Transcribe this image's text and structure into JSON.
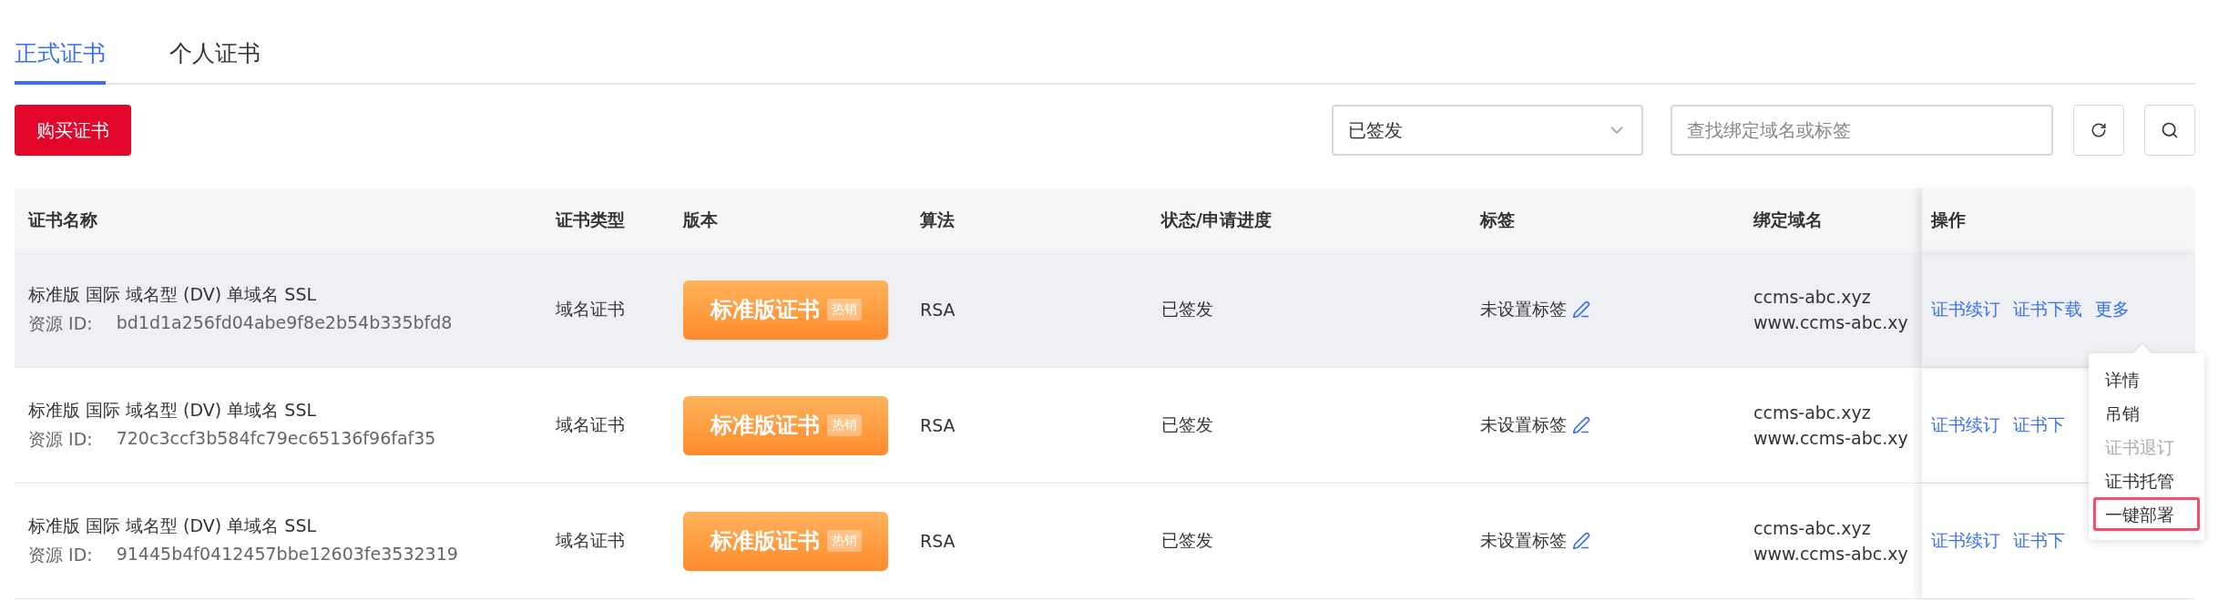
{
  "tabs": [
    {
      "label": "正式证书",
      "selected": true
    },
    {
      "label": "个人证书",
      "selected": false
    }
  ],
  "buy_button": "购买证书",
  "status_filter": {
    "value": "已签发"
  },
  "search": {
    "placeholder": "查找绑定域名或标签"
  },
  "table": {
    "columns": [
      "证书名称",
      "证书类型",
      "版本",
      "算法",
      "状态/申请进度",
      "标签",
      "绑定域名",
      "操作"
    ],
    "rows": [
      {
        "selected": true,
        "name": "标准版 国际 域名型 (DV) 单域名 SSL",
        "id_label": "资源 ID:",
        "resource_id": "bd1d1a256fd04abe9f8e2b54b335bfd8",
        "type": "域名证书",
        "version": "标准版证书",
        "version_tag": "热销",
        "algorithm": "RSA",
        "status": "已签发",
        "tag": "未设置标签",
        "domains": [
          "ccms-abc.xyz",
          "www.ccms-abc.xy"
        ],
        "actions": [
          "证书续订",
          "证书下载",
          "更多"
        ]
      },
      {
        "selected": false,
        "name": "标准版 国际 域名型 (DV) 单域名 SSL",
        "id_label": "资源 ID:",
        "resource_id": "720c3ccf3b584fc79ec65136f96faf35",
        "type": "域名证书",
        "version": "标准版证书",
        "version_tag": "热销",
        "algorithm": "RSA",
        "status": "已签发",
        "tag": "未设置标签",
        "domains": [
          "ccms-abc.xyz",
          "www.ccms-abc.xy"
        ],
        "actions": [
          "证书续订",
          "证书下"
        ]
      },
      {
        "selected": false,
        "name": "标准版 国际 域名型 (DV) 单域名 SSL",
        "id_label": "资源 ID:",
        "resource_id": "91445b4f0412457bbe12603fe3532319",
        "type": "域名证书",
        "version": "标准版证书",
        "version_tag": "热销",
        "algorithm": "RSA",
        "status": "已签发",
        "tag": "未设置标签",
        "domains": [
          "ccms-abc.xyz",
          "www.ccms-abc.xy"
        ],
        "actions": [
          "证书续订",
          "证书下"
        ]
      }
    ]
  },
  "more_menu": {
    "items": [
      {
        "label": "详情",
        "disabled": false,
        "highlighted": false
      },
      {
        "label": "吊销",
        "disabled": false,
        "highlighted": false
      },
      {
        "label": "证书退订",
        "disabled": true,
        "highlighted": false
      },
      {
        "label": "证书托管",
        "disabled": false,
        "highlighted": false
      },
      {
        "label": "一键部署",
        "disabled": false,
        "highlighted": true
      }
    ]
  }
}
